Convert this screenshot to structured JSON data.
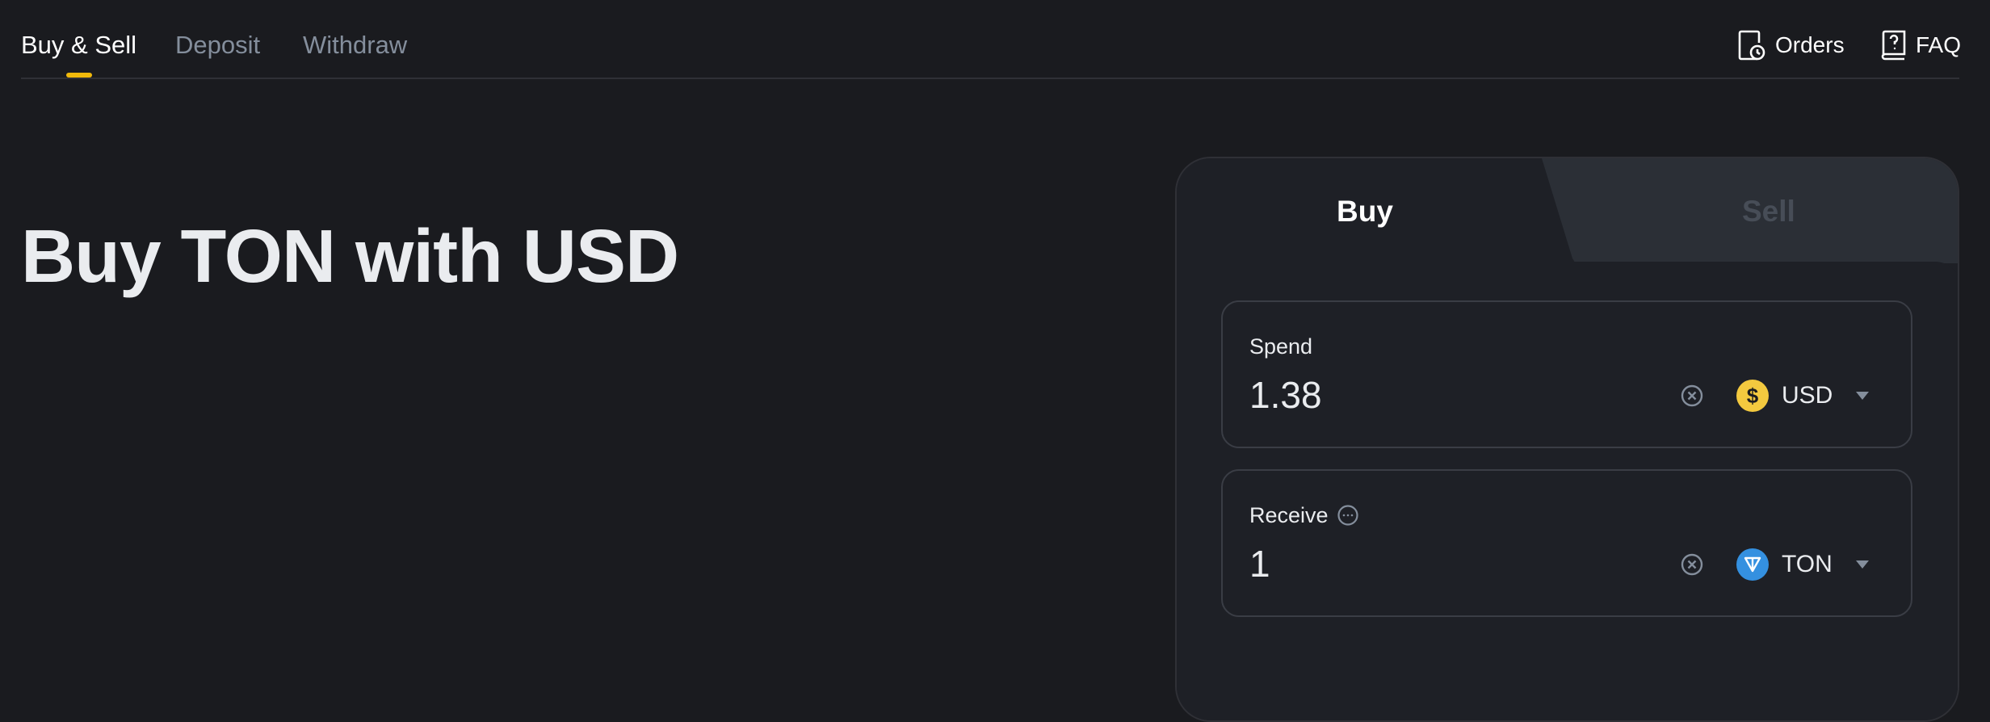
{
  "nav": {
    "tabs": [
      {
        "label": "Buy & Sell",
        "active": true
      },
      {
        "label": "Deposit",
        "active": false
      },
      {
        "label": "Withdraw",
        "active": false
      }
    ],
    "actions": {
      "orders": {
        "label": "Orders",
        "icon": "orders-clock-icon"
      },
      "faq": {
        "label": "FAQ",
        "icon": "faq-book-icon"
      }
    }
  },
  "hero": {
    "title": "Buy TON with USD"
  },
  "trade_card": {
    "tabs": {
      "buy": {
        "label": "Buy",
        "active": true
      },
      "sell": {
        "label": "Sell",
        "active": false
      }
    },
    "spend": {
      "label": "Spend",
      "amount": "1.38",
      "currency": "USD",
      "coin_icon": "usd-coin-icon"
    },
    "receive": {
      "label": "Receive",
      "amount": "1",
      "currency": "TON",
      "coin_icon": "ton-coin-icon",
      "info_icon": "more-info-icon"
    }
  },
  "colors": {
    "background": "#1a1b1f",
    "card": "#1e2026",
    "card_inactive_tab": "#2b2f36",
    "accent": "#f0b90b",
    "text_primary": "#eaecef",
    "text_muted": "#848e9c",
    "usd_coin": "#f3c93f",
    "ton_coin": "#3490e0"
  }
}
